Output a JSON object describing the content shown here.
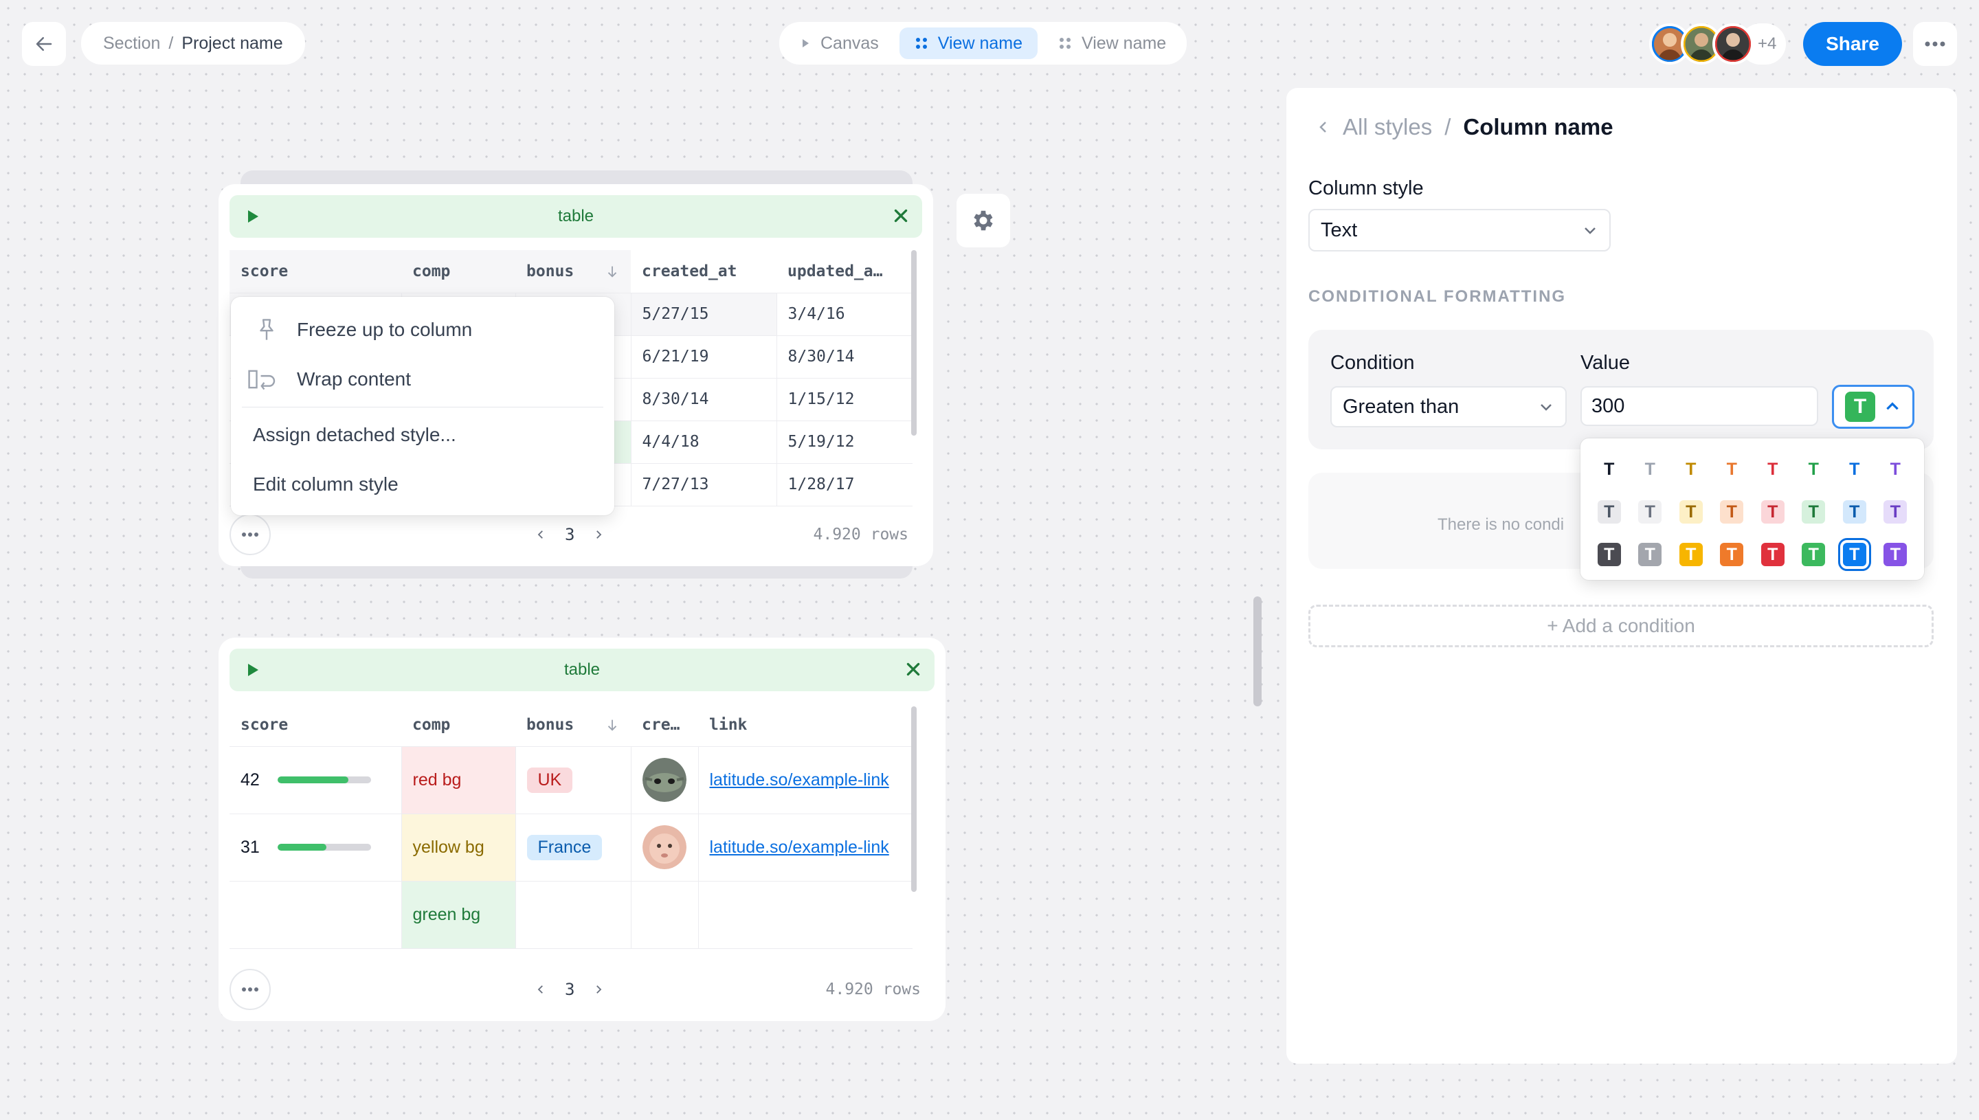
{
  "topbar": {
    "breadcrumb": {
      "section": "Section",
      "separator": "/",
      "project": "Project name"
    },
    "view_tabs": [
      {
        "label": "Canvas",
        "icon": "play-icon",
        "active": false
      },
      {
        "label": "View name",
        "icon": "grid-icon",
        "active": true
      },
      {
        "label": "View name",
        "icon": "grid-icon",
        "active": false
      }
    ],
    "avatars": [
      {
        "ring": "#0a7cf0",
        "bg": "#c77b4a"
      },
      {
        "ring": "#f4b400",
        "bg": "#6b7d5a"
      },
      {
        "ring": "#e53935",
        "bg": "#3c3c3c"
      }
    ],
    "avatars_more": "+4",
    "share_label": "Share"
  },
  "table1": {
    "title": "table",
    "columns": [
      "score",
      "comp",
      "bonus",
      "created_at",
      "updated_a…"
    ],
    "rows": [
      {
        "created_at": "5/27/15",
        "updated_at": "3/4/16"
      },
      {
        "created_at": "6/21/19",
        "updated_at": "8/30/14"
      },
      {
        "created_at": "8/30/14",
        "updated_at": "1/15/12"
      },
      {
        "created_at": "4/4/18",
        "updated_at": "5/19/12"
      },
      {
        "created_at": "7/27/13",
        "updated_at": "1/28/17"
      }
    ],
    "page": "3",
    "row_count": "4.920 rows"
  },
  "context_menu": {
    "items": [
      {
        "label": "Freeze up to column",
        "icon": "pin-icon"
      },
      {
        "label": "Wrap content",
        "icon": "wrap-icon"
      },
      {
        "label": "Assign detached style..."
      },
      {
        "label": "Edit column style"
      }
    ]
  },
  "table2": {
    "title": "table",
    "columns": [
      "score",
      "comp",
      "bonus",
      "cre…",
      "link"
    ],
    "rows": [
      {
        "score": "42",
        "progress": 0.76,
        "comp": "red bg",
        "bonus": "UK",
        "link": "latitude.so/example-link"
      },
      {
        "score": "31",
        "progress": 0.52,
        "comp": "yellow bg",
        "bonus": "France",
        "link": "latitude.so/example-link"
      },
      {
        "score": "",
        "progress": null,
        "comp": "green bg",
        "bonus": "",
        "link": ""
      }
    ],
    "page": "3",
    "row_count": "4.920 rows"
  },
  "panel": {
    "breadcrumb_parent": "All styles",
    "breadcrumb_sep": "/",
    "breadcrumb_current": "Column name",
    "column_style_label": "Column style",
    "column_style_value": "Text",
    "conditional_label": "CONDITIONAL FORMATTING",
    "condition_label": "Condition",
    "condition_value": "Greaten than",
    "value_label": "Value",
    "value_value": "300",
    "empty_text": "There is no condi",
    "add_condition": "+ Add a condition",
    "swatch_letter": "T",
    "swatches": [
      [
        {
          "fg": "#111827",
          "bg": "transparent"
        },
        {
          "fg": "#9ca3af",
          "bg": "transparent"
        },
        {
          "fg": "#c08a00",
          "bg": "transparent"
        },
        {
          "fg": "#e8772e",
          "bg": "transparent"
        },
        {
          "fg": "#dc2f3b",
          "bg": "transparent"
        },
        {
          "fg": "#22a04a",
          "bg": "transparent"
        },
        {
          "fg": "#0a6fe0",
          "bg": "transparent"
        },
        {
          "fg": "#7c4ddb",
          "bg": "transparent"
        }
      ],
      [
        {
          "fg": "#4b5563",
          "bg": "#e9e9ec"
        },
        {
          "fg": "#6b7280",
          "bg": "#f1f1f3"
        },
        {
          "fg": "#9a6b00",
          "bg": "#fdf0c6"
        },
        {
          "fg": "#c25a17",
          "bg": "#fde0cc"
        },
        {
          "fg": "#c62832",
          "bg": "#fbd6d9"
        },
        {
          "fg": "#1f7a3a",
          "bg": "#d6f1dd"
        },
        {
          "fg": "#0b5cad",
          "bg": "#d3e8fc"
        },
        {
          "fg": "#6a3dc4",
          "bg": "#e6dcfa"
        }
      ],
      [
        {
          "fg": "#ffffff",
          "bg": "#4b4b52"
        },
        {
          "fg": "#ffffff",
          "bg": "#a3a6ad"
        },
        {
          "fg": "#ffffff",
          "bg": "#f7b500"
        },
        {
          "fg": "#ffffff",
          "bg": "#ef7a2a"
        },
        {
          "fg": "#ffffff",
          "bg": "#e0313d"
        },
        {
          "fg": "#ffffff",
          "bg": "#3cb95e"
        },
        {
          "fg": "#ffffff",
          "bg": "#0a7cf0",
          "selected": true
        },
        {
          "fg": "#ffffff",
          "bg": "#8653e6"
        }
      ]
    ]
  }
}
